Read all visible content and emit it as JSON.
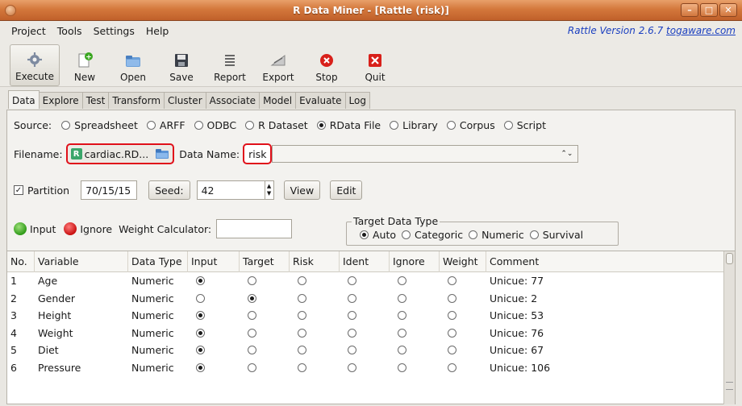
{
  "window": {
    "title": "R Data Miner - [Rattle (risk)]"
  },
  "menu": {
    "items": [
      "Project",
      "Tools",
      "Settings",
      "Help"
    ],
    "version_prefix": "Rattle Version 2.6.7 ",
    "version_link": "togaware.com"
  },
  "toolbar": [
    {
      "label": "Execute",
      "icon": "gear-icon"
    },
    {
      "label": "New",
      "icon": "new-document-icon"
    },
    {
      "label": "Open",
      "icon": "open-folder-icon"
    },
    {
      "label": "Save",
      "icon": "save-disk-icon"
    },
    {
      "label": "Report",
      "icon": "report-icon"
    },
    {
      "label": "Export",
      "icon": "export-icon"
    },
    {
      "label": "Stop",
      "icon": "stop-icon"
    },
    {
      "label": "Quit",
      "icon": "quit-icon"
    }
  ],
  "tabs": [
    "Data",
    "Explore",
    "Test",
    "Transform",
    "Cluster",
    "Associate",
    "Model",
    "Evaluate",
    "Log"
  ],
  "source": {
    "label": "Source:",
    "options": [
      "Spreadsheet",
      "ARFF",
      "ODBC",
      "R Dataset",
      "RData File",
      "Library",
      "Corpus",
      "Script"
    ],
    "selected": "RData File"
  },
  "file": {
    "label": "Filename:",
    "value": "cardiac.RD...",
    "dataname_label": "Data Name:",
    "dataname_value": "risk",
    "combo_arrow": "⌃⌄"
  },
  "partition": {
    "label": "Partition",
    "value": "70/15/15",
    "seed_label": "Seed:",
    "seed_value": "42",
    "view_label": "View",
    "edit_label": "Edit"
  },
  "roles": {
    "input": "Input",
    "ignore": "Ignore",
    "weight_label": "Weight Calculator:",
    "weight_value": ""
  },
  "target_type": {
    "legend": "Target Data Type",
    "options": [
      "Auto",
      "Categoric",
      "Numeric",
      "Survival"
    ],
    "selected": "Auto"
  },
  "table": {
    "columns": [
      "No.",
      "Variable",
      "Data Type",
      "Input",
      "Target",
      "Risk",
      "Ident",
      "Ignore",
      "Weight",
      "Comment"
    ],
    "rows": [
      {
        "no": "1",
        "variable": "Age",
        "type": "Numeric",
        "role": "Input",
        "comment": "Unicue: 77"
      },
      {
        "no": "2",
        "variable": "Gender",
        "type": "Numeric",
        "role": "Target",
        "comment": "Unicue: 2"
      },
      {
        "no": "3",
        "variable": "Height",
        "type": "Numeric",
        "role": "Input",
        "comment": "Unicue: 53"
      },
      {
        "no": "4",
        "variable": "Weight",
        "type": "Numeric",
        "role": "Input",
        "comment": "Unicue: 76"
      },
      {
        "no": "5",
        "variable": "Diet",
        "type": "Numeric",
        "role": "Input",
        "comment": "Unicue: 67"
      },
      {
        "no": "6",
        "variable": "Pressure",
        "type": "Numeric",
        "role": "Input",
        "comment": "Unicue: 106"
      }
    ]
  },
  "colors": {
    "titlebar": "#d4783c",
    "highlight": "#e0101a",
    "link": "#1a3fc0"
  }
}
